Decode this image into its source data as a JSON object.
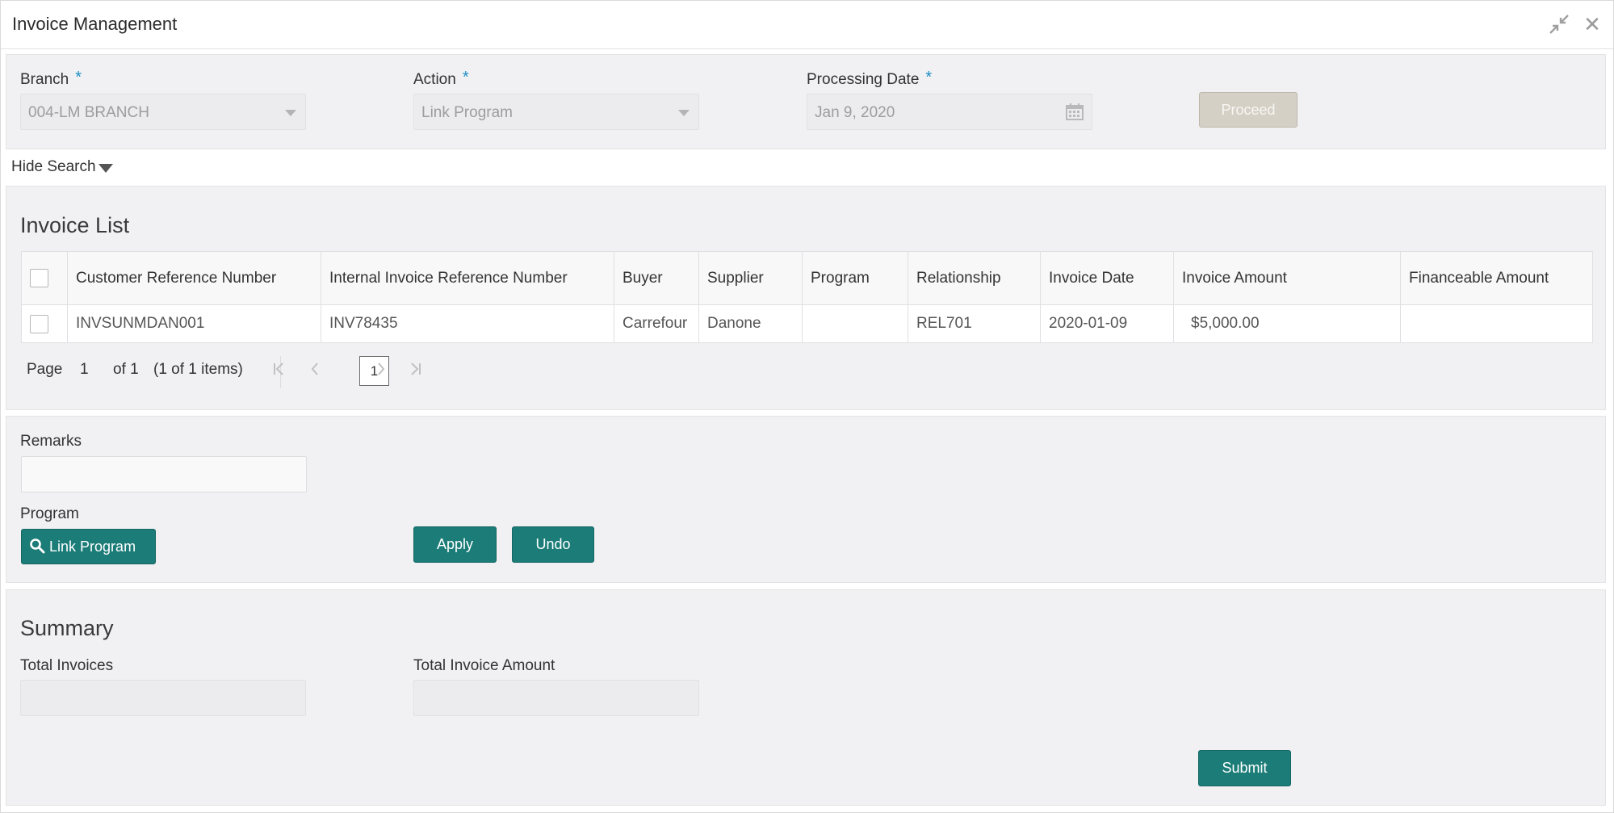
{
  "window": {
    "title": "Invoice Management"
  },
  "search": {
    "branch": {
      "label": "Branch",
      "value": "004-LM BRANCH"
    },
    "action": {
      "label": "Action",
      "value": "Link Program"
    },
    "processing_date": {
      "label": "Processing Date",
      "value": "Jan 9, 2020"
    },
    "required_mark": "*",
    "proceed_label": "Proceed",
    "hide_search_label": "Hide Search"
  },
  "invoice_list": {
    "title": "Invoice List",
    "columns": [
      "Customer Reference Number",
      "Internal Invoice Reference Number",
      "Buyer",
      "Supplier",
      "Program",
      "Relationship",
      "Invoice Date",
      "Invoice Amount",
      "Financeable Amount"
    ],
    "rows": [
      {
        "customer_ref": "INVSUNMDAN001",
        "internal_ref": "INV78435",
        "buyer": "Carrefour",
        "supplier": "Danone",
        "program": "",
        "relationship": "REL701",
        "invoice_date": "2020-01-09",
        "invoice_amount": "$5,000.00",
        "financeable_amount": ""
      }
    ],
    "pager": {
      "page_label": "Page",
      "page_value": "1",
      "of_label": "of 1",
      "items_label": "(1 of 1 items)",
      "current_page": "1"
    }
  },
  "remarks": {
    "label": "Remarks",
    "value": "",
    "program_label": "Program",
    "link_program_label": "Link Program",
    "apply_label": "Apply",
    "undo_label": "Undo"
  },
  "summary": {
    "title": "Summary",
    "total_invoices_label": "Total Invoices",
    "total_invoices_value": "",
    "total_amount_label": "Total Invoice Amount",
    "total_amount_value": "",
    "submit_label": "Submit"
  },
  "colors": {
    "primary_button": "#1b7c78",
    "link": "#1f6fb2",
    "required": "#1e8fc6",
    "disabled_button": "#d5d0c6"
  },
  "icons": [
    "minimize-icon",
    "close-icon",
    "chevron-down-icon",
    "calendar-icon",
    "search-icon",
    "first-page-icon",
    "prev-page-icon",
    "next-page-icon",
    "last-page-icon"
  ]
}
